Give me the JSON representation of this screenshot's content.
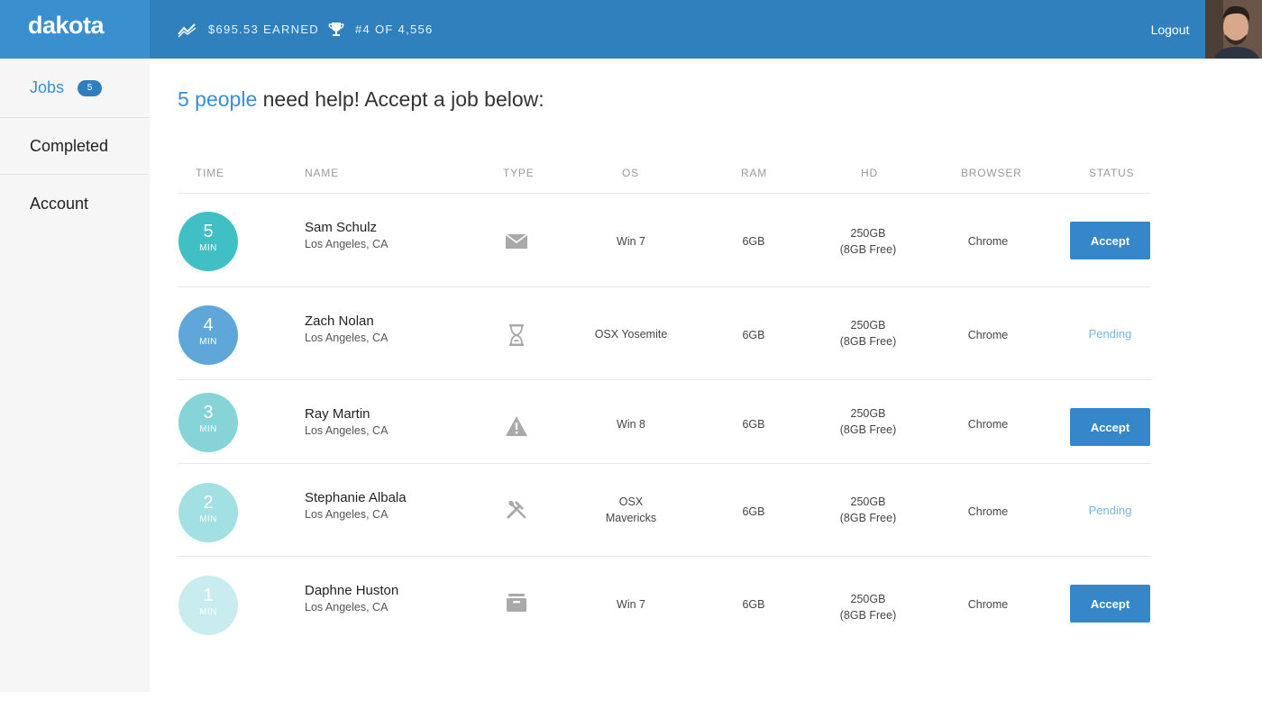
{
  "app": {
    "brand": "dakota",
    "earned": "$695.53 EARNED",
    "rank": "#4 OF 4,556",
    "logout": "Logout"
  },
  "sidebar": {
    "items": [
      {
        "label": "Jobs",
        "badge": "5",
        "active": true
      },
      {
        "label": "Completed"
      },
      {
        "label": "Account"
      }
    ]
  },
  "main": {
    "headline_highlight": "5 people",
    "headline_rest": " need help! Accept a job below:",
    "columns": [
      "TIME",
      "NAME",
      "TYPE",
      "OS",
      "RAM",
      "HD",
      "BROWSER",
      "STATUS"
    ],
    "rows": [
      {
        "time": "5",
        "unit": "MIN",
        "name": "Sam Schulz",
        "location": "Los Angeles, CA",
        "type_icon": "envelope-icon",
        "os_line1": "Win 7",
        "os_line2": "",
        "ram": "6GB",
        "hd_line1": "250GB",
        "hd_line2": "(8GB Free)",
        "browser": "Chrome",
        "status": "Accept",
        "status_kind": "button",
        "color": "#40bfc4"
      },
      {
        "time": "4",
        "unit": "MIN",
        "name": "Zach Nolan",
        "location": "Los Angeles, CA",
        "type_icon": "hourglass-icon",
        "os_line1": "OSX Yosemite",
        "os_line2": "",
        "ram": "6GB",
        "hd_line1": "250GB",
        "hd_line2": "(8GB Free)",
        "browser": "Chrome",
        "status": "Pending",
        "status_kind": "text",
        "color": "#5fa7d9"
      },
      {
        "time": "3",
        "unit": "MIN",
        "name": "Ray Martin",
        "location": "Los Angeles, CA",
        "type_icon": "warning-icon",
        "os_line1": "Win 8",
        "os_line2": "",
        "ram": "6GB",
        "hd_line1": "250GB",
        "hd_line2": "(8GB Free)",
        "browser": "Chrome",
        "status": "Accept",
        "status_kind": "button",
        "color": "#86d4d8"
      },
      {
        "time": "2",
        "unit": "MIN",
        "name": "Stephanie Albala",
        "location": "Los Angeles, CA",
        "type_icon": "tools-icon",
        "os_line1": "OSX",
        "os_line2": "Mavericks",
        "ram": "6GB",
        "hd_line1": "250GB",
        "hd_line2": "(8GB Free)",
        "browser": "Chrome",
        "status": "Pending",
        "status_kind": "text",
        "color": "#a3e0e3"
      },
      {
        "time": "1",
        "unit": "MIN",
        "name": "Daphne Huston",
        "location": "Los Angeles, CA",
        "type_icon": "inbox-icon",
        "os_line1": "Win 7",
        "os_line2": "",
        "ram": "6GB",
        "hd_line1": "250GB",
        "hd_line2": "(8GB Free)",
        "browser": "Chrome",
        "status": "Accept",
        "status_kind": "button",
        "color": "#c9ecee"
      }
    ]
  }
}
